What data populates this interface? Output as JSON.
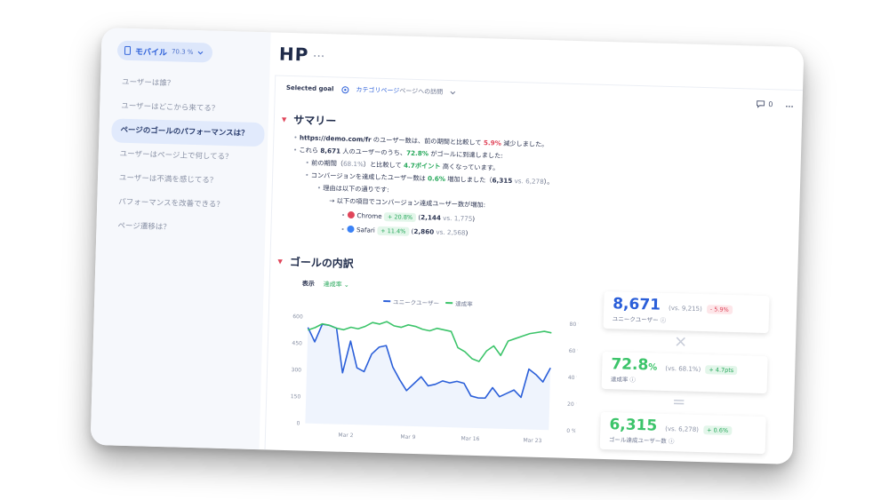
{
  "sidebar": {
    "device": {
      "label": "モバイル",
      "pct": "70.3 %"
    },
    "items": [
      {
        "label": "ユーザーは誰？",
        "active": false
      },
      {
        "label": "ユーザーはどこから来てる？",
        "active": false
      },
      {
        "label": "ページのゴールのパフォーマンスは？",
        "active": true
      },
      {
        "label": "ユーザーはページ上で何してる？",
        "active": false
      },
      {
        "label": "ユーザーは不満を感じてる？",
        "active": false
      },
      {
        "label": "パフォーマンスを改善できる？",
        "active": false
      },
      {
        "label": "ページ遷移は？",
        "active": false
      }
    ]
  },
  "header": {
    "title": "HP",
    "more": "..."
  },
  "goal": {
    "label": "Selected goal",
    "value": "カテゴリページ",
    "suffix": "ページへの訪問"
  },
  "tools": {
    "comments": "0",
    "more": "..."
  },
  "summary": {
    "heading": "サマリー",
    "l1": {
      "url": "https://demo.com/fr",
      "t1": " のユーザー数は、前の期間と比較して ",
      "pct": "5.9%",
      "t2": " 減少しました。"
    },
    "l2": {
      "t1": "これら ",
      "n": "8,671",
      "t2": " 人のユーザーのうち、",
      "pct": "72.8%",
      "t3": " がゴールに到達しました:"
    },
    "l3": {
      "t1": "前の期間（",
      "prev": "68.1%",
      "t2": "）と比較して ",
      "pts": "4.7ポイント",
      "t3": " 高くなっています。"
    },
    "l4": {
      "t1": "コンバージョンを達成したユーザー数は ",
      "pct": "0.6%",
      "t2": " 増加しました（",
      "n": "6,315",
      "vs": " vs. 6,278",
      "t3": "）。"
    },
    "l5": "理由は以下の通りです:",
    "l6": "→ 以下の項目でコンバージョン達成ユーザー数が増加:",
    "browsers": [
      {
        "name": "Chrome",
        "chip": "+ 20.8%",
        "n": "2,144",
        "vs": " vs. 1,775",
        "color": "#e0455a"
      },
      {
        "name": "Safari",
        "chip": "+ 11.4%",
        "n": "2,860",
        "vs": " vs. 2,568",
        "color": "#3b82f6"
      }
    ]
  },
  "breakdown": {
    "heading": "ゴールの内訳",
    "display_label": "表示",
    "display_value": "達成率"
  },
  "chart_data": {
    "type": "line",
    "legend": [
      "ユニークユーザー",
      "達成率"
    ],
    "x_labels": [
      "Mar 2",
      "Mar 9",
      "Mar 16",
      "Mar 23"
    ],
    "y_left": {
      "ticks": [
        "600",
        "450",
        "300",
        "150",
        "0"
      ],
      "range": [
        0,
        600
      ]
    },
    "y_right": {
      "ticks": [
        "80 %",
        "60 %",
        "40 %",
        "20 %",
        "0 %"
      ],
      "range": [
        0,
        80
      ]
    },
    "series": [
      {
        "name": "ユニークユーザー",
        "color": "#2b5fd9",
        "values": [
          540,
          460,
          560,
          555,
          540,
          290,
          470,
          320,
          300,
          400,
          440,
          450,
          330,
          260,
          200,
          240,
          280,
          230,
          240,
          260,
          250,
          260,
          250,
          180,
          170,
          170,
          230,
          180,
          200,
          220,
          180,
          340,
          310,
          270,
          350
        ]
      },
      {
        "name": "達成率",
        "color": "#3cc46a",
        "values": [
          70,
          72,
          75,
          74,
          72,
          71,
          73,
          72,
          74,
          77,
          76,
          78,
          75,
          74,
          76,
          75,
          73,
          72,
          74,
          73,
          72,
          60,
          57,
          52,
          50,
          58,
          62,
          55,
          66,
          68,
          70,
          72,
          73,
          74,
          73
        ]
      }
    ]
  },
  "kpis": [
    {
      "value": "8,671",
      "vs": "(vs. 9,215)",
      "chip": "- 5.9%",
      "chip_type": "red",
      "label": "ユニークユーザー",
      "color": "#2b5fd9"
    },
    {
      "value": "72.8",
      "unit": "%",
      "vs": "(vs. 68.1%)",
      "chip": "+ 4.7pts",
      "chip_type": "green",
      "label": "達成率",
      "color": "#3cc46a"
    },
    {
      "value": "6,315",
      "vs": "(vs. 6,278)",
      "chip": "+ 0.6%",
      "chip_type": "green",
      "label": "ゴール達成ユーザー数",
      "color": "#3cc46a"
    }
  ],
  "ops": {
    "times": "×",
    "equals": "="
  }
}
